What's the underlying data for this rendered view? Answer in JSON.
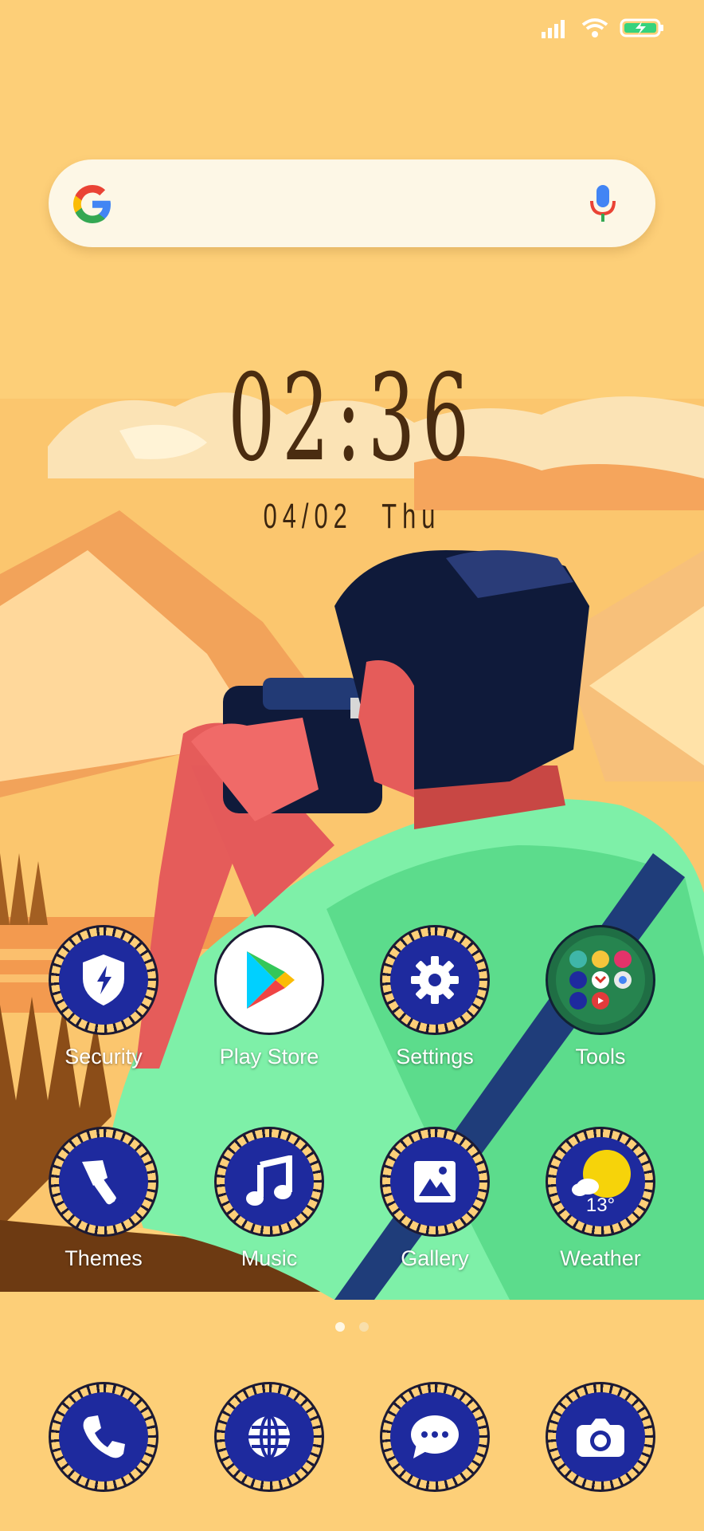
{
  "status": {
    "icons": [
      "signal-icon",
      "wifi-icon",
      "battery-charging-icon"
    ]
  },
  "search": {
    "logo": "google-g-icon",
    "mic": "mic-icon"
  },
  "clock": {
    "time": "02:36",
    "date": "04/02",
    "day": "Thu"
  },
  "apps_row1": [
    {
      "label": "Security",
      "icon": "shield-bolt-icon"
    },
    {
      "label": "Play Store",
      "icon": "play-store-icon"
    },
    {
      "label": "Settings",
      "icon": "gear-icon"
    },
    {
      "label": "Tools",
      "icon": "folder-icon"
    }
  ],
  "apps_row2": [
    {
      "label": "Themes",
      "icon": "paintbrush-icon"
    },
    {
      "label": "Music",
      "icon": "music-note-icon"
    },
    {
      "label": "Gallery",
      "icon": "image-icon"
    },
    {
      "label": "Weather",
      "icon": "weather-icon",
      "temp": "13°"
    }
  ],
  "page_indicator": {
    "pages": 2,
    "current": 1
  },
  "dock": [
    {
      "icon": "phone-icon"
    },
    {
      "icon": "browser-globe-icon"
    },
    {
      "icon": "messages-icon"
    },
    {
      "icon": "camera-icon"
    }
  ],
  "colors": {
    "background": "#fdcf78",
    "icon_blue": "#1e2a9e",
    "jacket_green": "#7ef0a8"
  }
}
